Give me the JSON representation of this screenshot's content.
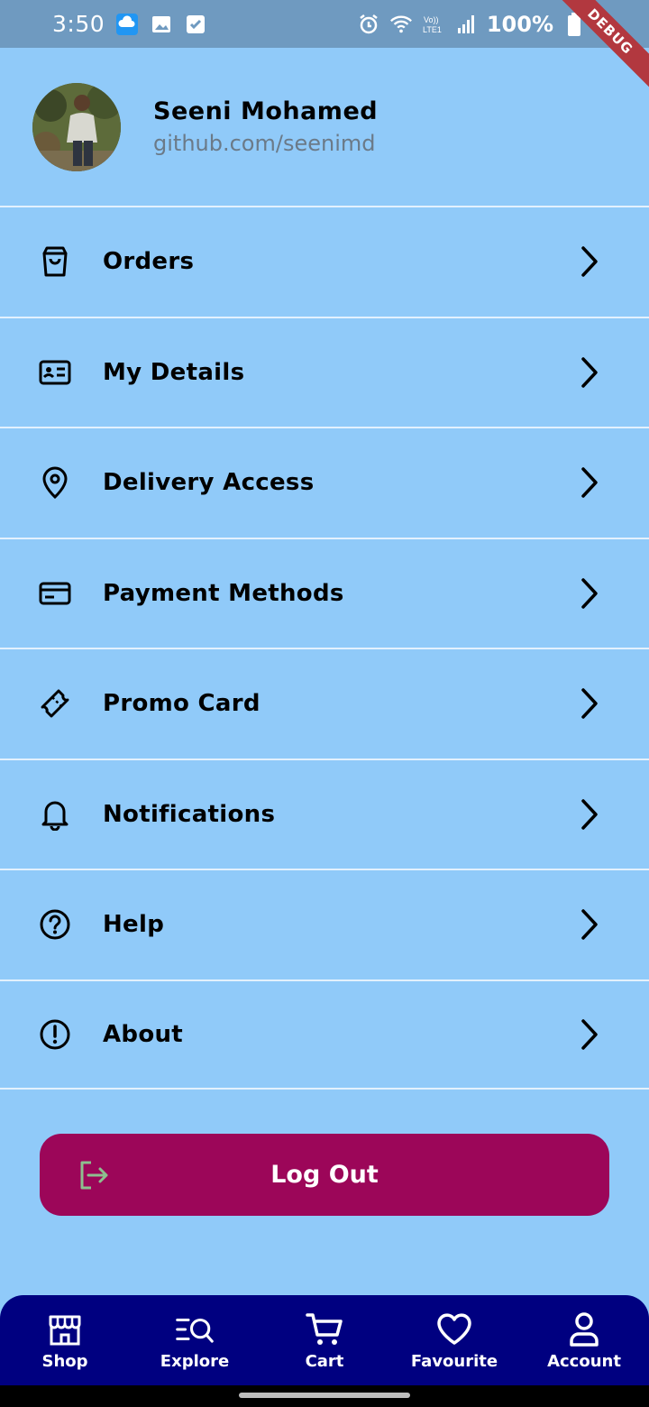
{
  "status_bar": {
    "time": "3:50",
    "battery": "100%",
    "debug_banner": "DEBUG"
  },
  "profile": {
    "name": "Seeni Mohamed",
    "handle": "github.com/seenimd"
  },
  "menu": {
    "items": [
      {
        "label": "Orders",
        "icon": "shopping-bag-icon"
      },
      {
        "label": "My Details",
        "icon": "id-card-icon"
      },
      {
        "label": "Delivery Access",
        "icon": "location-pin-icon"
      },
      {
        "label": "Payment Methods",
        "icon": "credit-card-icon"
      },
      {
        "label": "Promo Card",
        "icon": "ticket-icon"
      },
      {
        "label": "Notifications",
        "icon": "bell-icon"
      },
      {
        "label": "Help",
        "icon": "question-circle-icon"
      },
      {
        "label": "About",
        "icon": "info-circle-icon"
      }
    ]
  },
  "logout": {
    "label": "Log Out",
    "icon": "logout-icon"
  },
  "bottom_nav": {
    "items": [
      {
        "label": "Shop",
        "icon": "store-icon"
      },
      {
        "label": "Explore",
        "icon": "explore-search-icon"
      },
      {
        "label": "Cart",
        "icon": "cart-icon"
      },
      {
        "label": "Favourite",
        "icon": "heart-icon"
      },
      {
        "label": "Account",
        "icon": "user-icon"
      }
    ],
    "active": "Account"
  },
  "colors": {
    "background": "#90CAF9",
    "status_bar": "#6F9AC0",
    "logout_button": "#9C0659",
    "bottom_nav": "#000080",
    "divider": "#E3F1FD"
  }
}
